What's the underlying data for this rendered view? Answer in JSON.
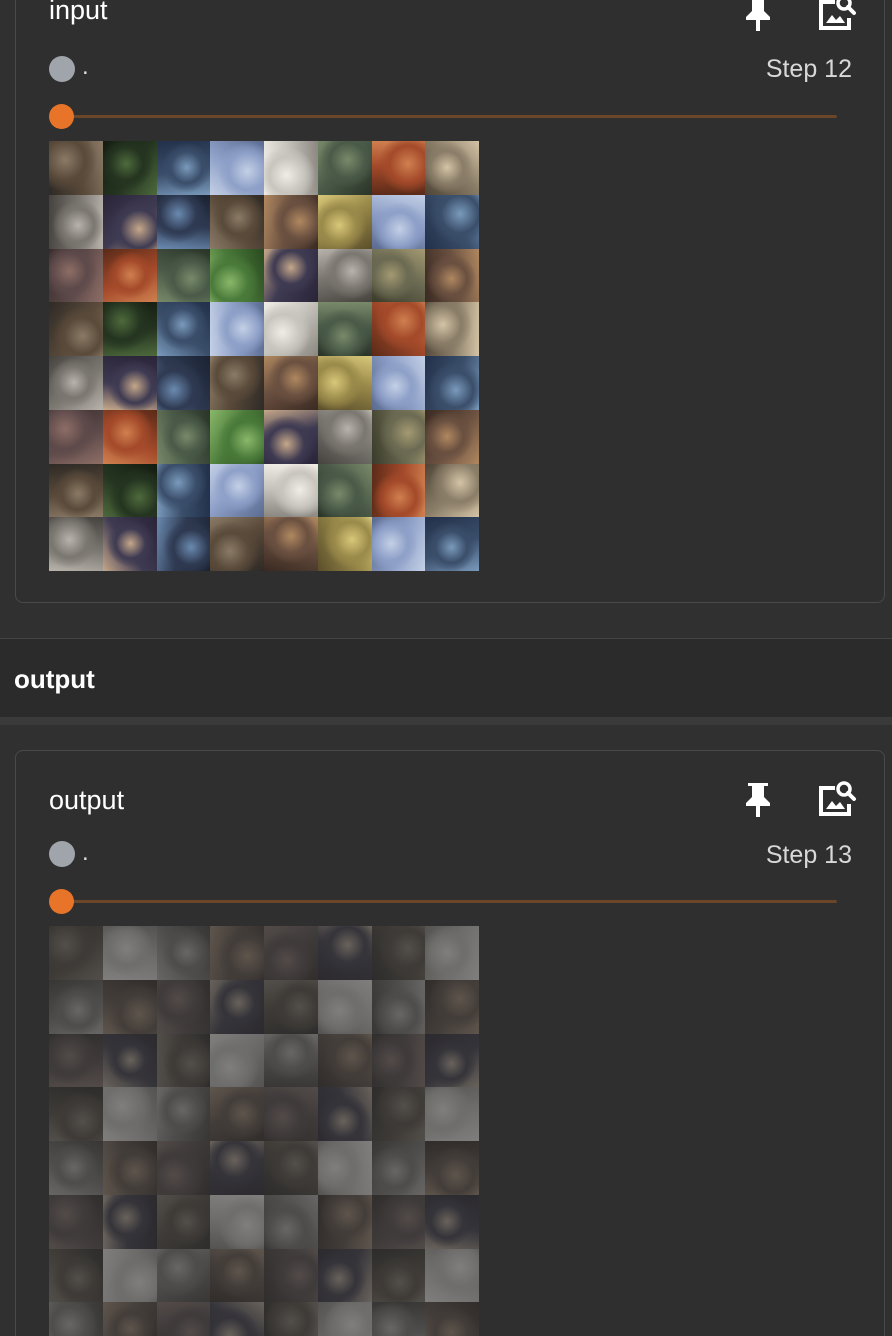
{
  "colors": {
    "background": "#303030",
    "accent": "#e8742a",
    "track": "#6b4628",
    "run_dot": "#a0a4ab"
  },
  "cards": [
    {
      "title": "input",
      "run_label": ".",
      "step_label": "Step 12",
      "slider_value": 0,
      "pin_icon": "pin-icon",
      "zoom_icon": "image-search-icon",
      "faded": false
    },
    {
      "title": "output",
      "run_label": ".",
      "step_label": "Step 13",
      "slider_value": 0,
      "pin_icon": "pin-icon",
      "zoom_icon": "image-search-icon",
      "faded": true
    }
  ],
  "section": {
    "label": "output"
  }
}
